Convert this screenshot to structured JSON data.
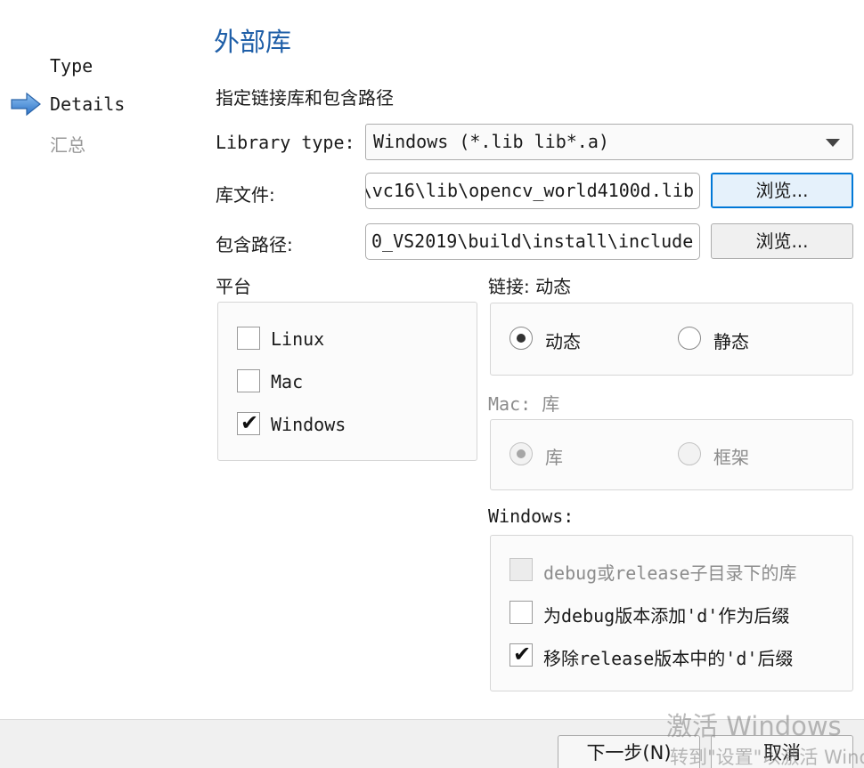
{
  "steps": [
    {
      "label": "Type",
      "state": "done"
    },
    {
      "label": "Details",
      "state": "current"
    },
    {
      "label": "汇总",
      "state": "pending"
    }
  ],
  "page": {
    "title": "外部库",
    "subtitle": "指定链接库和包含路径"
  },
  "library_type": {
    "label": "Library type:",
    "value": "Windows (*.lib lib*.a)"
  },
  "library_file": {
    "label": "库文件:",
    "value": "\\vc16\\lib\\opencv_world4100d.lib",
    "browse": "浏览..."
  },
  "include_path": {
    "label": "包含路径:",
    "value": "0_VS2019\\build\\install\\include",
    "browse": "浏览..."
  },
  "platform": {
    "label": "平台",
    "options": [
      {
        "label": "Linux",
        "checked": false
      },
      {
        "label": "Mac",
        "checked": false
      },
      {
        "label": "Windows",
        "checked": true
      }
    ]
  },
  "linkage": {
    "label": "链接: 动态",
    "options": [
      {
        "label": "动态",
        "selected": true
      },
      {
        "label": "静态",
        "selected": false
      }
    ]
  },
  "mac": {
    "label": "Mac: 库",
    "options": [
      {
        "label": "库",
        "selected": true,
        "disabled": true
      },
      {
        "label": "框架",
        "selected": false,
        "disabled": true
      }
    ]
  },
  "windows": {
    "label": "Windows:",
    "options": [
      {
        "label": "debug或release子目录下的库",
        "checked": false,
        "disabled": true
      },
      {
        "label": "为debug版本添加'd'作为后缀",
        "checked": false,
        "disabled": false
      },
      {
        "label": "移除release版本中的'd'后缀",
        "checked": true,
        "disabled": false
      }
    ]
  },
  "footer": {
    "next": "下一步(N)",
    "cancel": "取消"
  },
  "watermark": {
    "line1": "激活 Windows",
    "line2": "转到\"设置\"以激活 Windows。"
  },
  "colors": {
    "title": "#1f5fa8",
    "arrow": "#3a86d8",
    "focus": "#0078d7"
  }
}
